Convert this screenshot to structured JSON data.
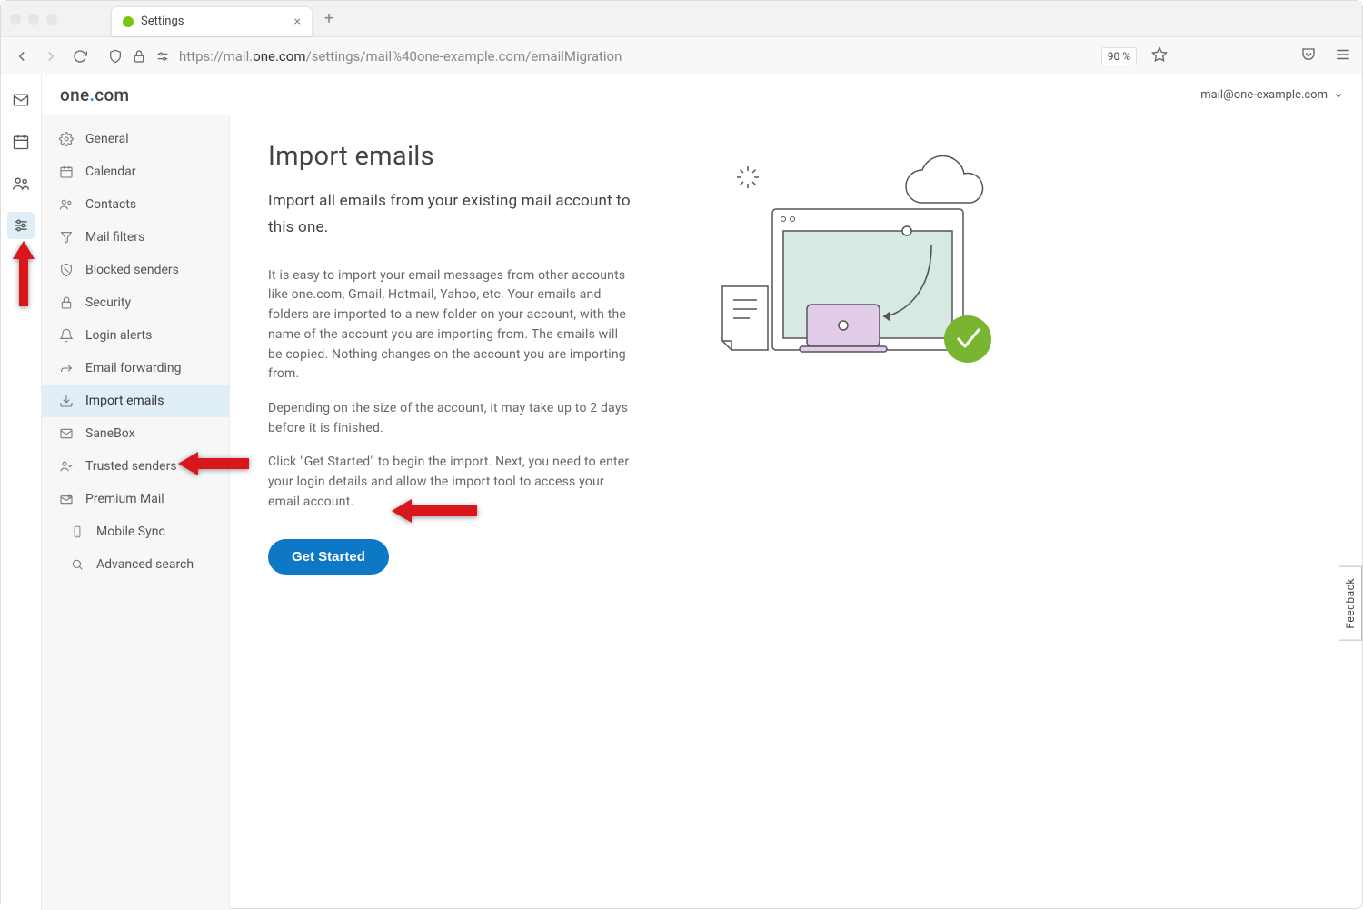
{
  "browser": {
    "tab_title": "Settings",
    "url_prefix": "https://mail.",
    "url_domain": "one.com",
    "url_path": "/settings/mail%40one-example.com/emailMigration",
    "zoom": "90 %"
  },
  "header": {
    "logo_pre": "one",
    "logo_dot": ".",
    "logo_post": "com",
    "account_email": "mail@one-example.com"
  },
  "rail": {
    "items": [
      {
        "name": "mail",
        "icon": "mail"
      },
      {
        "name": "calendar",
        "icon": "calendar"
      },
      {
        "name": "contacts",
        "icon": "contacts"
      },
      {
        "name": "settings",
        "icon": "sliders",
        "active": true
      }
    ]
  },
  "sidebar": {
    "items": [
      {
        "label": "General",
        "icon": "gear"
      },
      {
        "label": "Calendar",
        "icon": "calendar"
      },
      {
        "label": "Contacts",
        "icon": "contacts"
      },
      {
        "label": "Mail filters",
        "icon": "filter"
      },
      {
        "label": "Blocked senders",
        "icon": "shield"
      },
      {
        "label": "Security",
        "icon": "lock"
      },
      {
        "label": "Login alerts",
        "icon": "bell"
      },
      {
        "label": "Email forwarding",
        "icon": "forward"
      },
      {
        "label": "Import emails",
        "icon": "import",
        "active": true
      },
      {
        "label": "SaneBox",
        "icon": "envelope"
      },
      {
        "label": "Trusted senders",
        "icon": "trusted"
      },
      {
        "label": "Premium Mail",
        "icon": "premium"
      },
      {
        "label": "Mobile Sync",
        "icon": "mobile",
        "sub": true
      },
      {
        "label": "Advanced search",
        "icon": "search",
        "sub": true
      }
    ]
  },
  "content": {
    "title": "Import emails",
    "subtitle": "Import all emails from your existing mail account to this one.",
    "para1": "It is easy to import your email messages from other accounts like one.com, Gmail, Hotmail, Yahoo, etc. Your emails and folders are imported to a new folder on your account, with the name of the account you are importing from. The emails will be copied. Nothing changes on the account you are importing from.",
    "para2": "Depending on the size of the account, it may take up to 2 days before it is finished.",
    "para3": "Click \"Get Started\" to begin the import. Next, you need to enter your login details and allow the import tool to access your email account.",
    "button": "Get Started"
  },
  "feedback": {
    "label": "Feedback"
  }
}
